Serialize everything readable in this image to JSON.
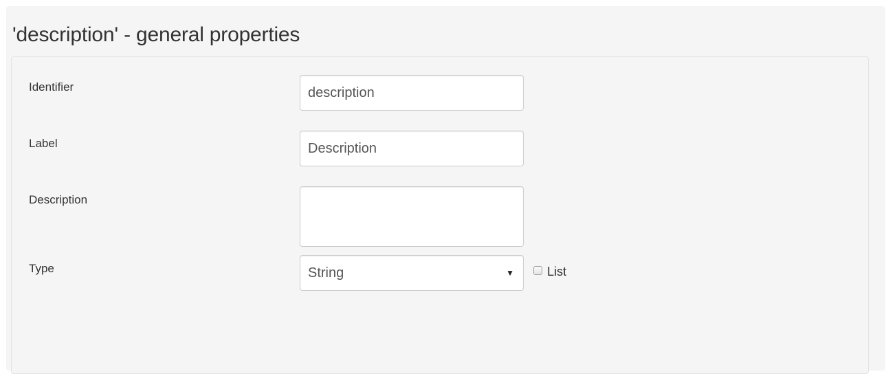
{
  "panel_title": "'description' - general properties",
  "fields": {
    "identifier": {
      "label": "Identifier",
      "value": "description"
    },
    "label": {
      "label": "Label",
      "value": "Description"
    },
    "description": {
      "label": "Description",
      "value": ""
    },
    "type": {
      "label": "Type",
      "selected": "String",
      "arrow_glyph": "▼"
    }
  },
  "list_checkbox": {
    "label": "List",
    "checked": false
  }
}
